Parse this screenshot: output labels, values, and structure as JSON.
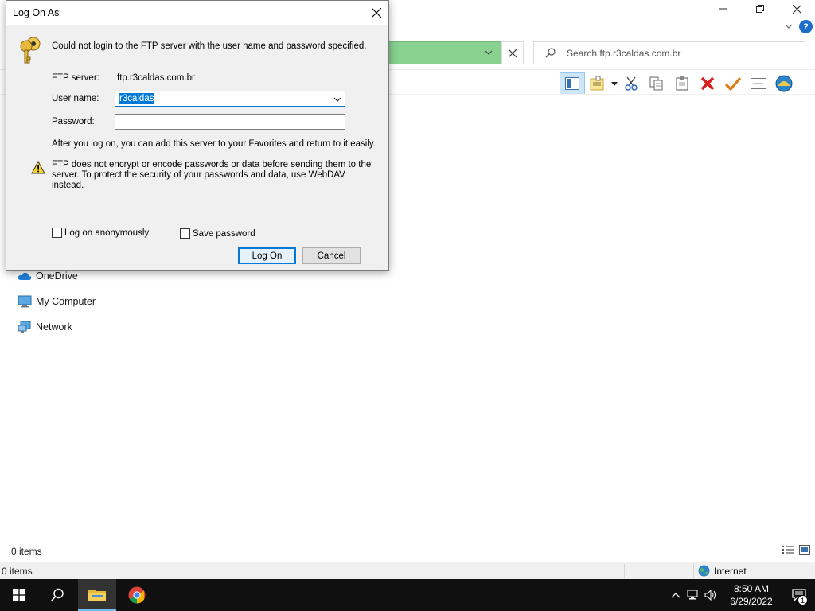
{
  "dialog": {
    "title": "Log On As",
    "message": "Could not login to the FTP server with the user name and password specified.",
    "ftp_server_label": "FTP server:",
    "ftp_server_value": "ftp.r3caldas.com.br",
    "username_label": "User name:",
    "username_value": "r3caldas",
    "password_label": "Password:",
    "password_value": "",
    "info_text": "After you log on, you can add this server to your Favorites and return to it easily.",
    "warning_text": "FTP does not encrypt or encode passwords or data before sending them to the server.  To protect the security of your passwords and data, use WebDAV instead.",
    "anonymous_label": "Log on anonymously",
    "anonymous_checked": false,
    "save_password_label": "Save password",
    "save_password_checked": false,
    "logon_button": "Log On",
    "cancel_button": "Cancel"
  },
  "explorer": {
    "search_placeholder": "Search ftp.r3caldas.com.br",
    "nav_items": [
      {
        "label": "OneDrive",
        "icon": "onedrive-icon"
      },
      {
        "label": "My Computer",
        "icon": "computer-icon"
      },
      {
        "label": "Network",
        "icon": "network-icon"
      }
    ],
    "items_count": "0 items",
    "status_count": "0 items",
    "zone": "Internet",
    "accent_color": "#88d18f"
  },
  "taskbar": {
    "time": "8:50 AM",
    "date": "6/29/2022",
    "notification_count": "1"
  }
}
